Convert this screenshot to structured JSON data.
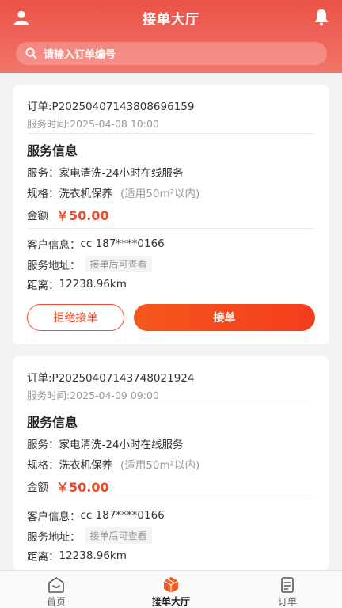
{
  "header": {
    "title": "接单大厅",
    "user_icon": "user-icon",
    "bell_icon": "bell-icon"
  },
  "search": {
    "placeholder": "请输入订单编号",
    "icon": "search-icon"
  },
  "orders": [
    {
      "order_no": "订单:P20250407143808696159",
      "service_time": "服务时间:2025-04-08 10:00",
      "section_title": "服务信息",
      "service_label": "服务：",
      "service_value": "家电清洗-24小时在线服务",
      "spec_label": "规格：",
      "spec_value": "洗衣机保养",
      "spec_note": "(适用50m²以内)",
      "amount_label": "金额",
      "amount_value": "￥50.00",
      "customer_label": "客户信息：",
      "customer_value": "cc 187****0166",
      "address_label": "服务地址：",
      "address_value": "接单后可查看",
      "distance_label": "距离：",
      "distance_value": "12238.96km",
      "reject_label": "拒绝接单",
      "accept_label": "接单"
    },
    {
      "order_no": "订单:P20250407143748021924",
      "service_time": "服务时间:2025-04-09 09:00",
      "section_title": "服务信息",
      "service_label": "服务：",
      "service_value": "家电清洗-24小时在线服务",
      "spec_label": "规格：",
      "spec_value": "洗衣机保养",
      "spec_note": "(适用50m²以内)",
      "amount_label": "金额",
      "amount_value": "￥50.00",
      "customer_label": "客户信息：",
      "customer_value": "cc 187****0166",
      "address_label": "服务地址：",
      "address_value": "接单后可查看",
      "distance_label": "距离：",
      "distance_value": "12238.96km"
    }
  ],
  "tabbar": {
    "items": [
      {
        "label": "首页",
        "icon": "home-icon",
        "active": false
      },
      {
        "label": "接单大厅",
        "icon": "box-icon",
        "active": true
      },
      {
        "label": "订单",
        "icon": "document-icon",
        "active": false
      }
    ]
  },
  "colors": {
    "header_start": "#ea5246",
    "accent": "#ee4b2b",
    "button_gradient_start": "#f4571c",
    "button_gradient_end": "#f43d1c"
  }
}
